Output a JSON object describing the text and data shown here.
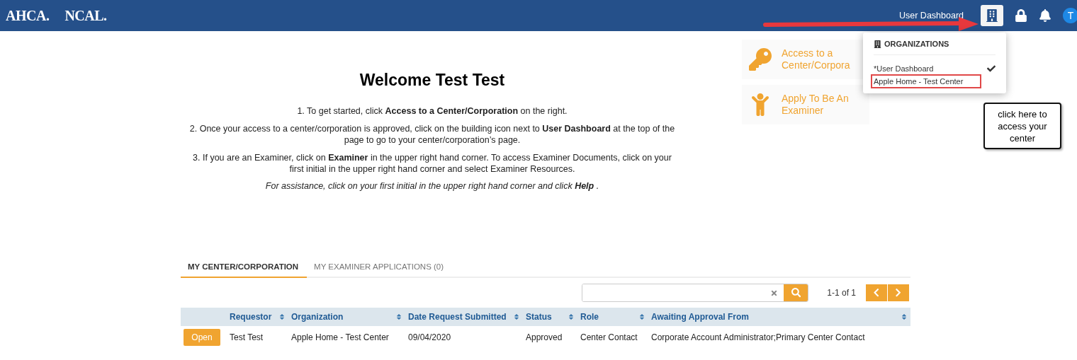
{
  "header": {
    "logos": [
      "AHCA.",
      "NCAL."
    ],
    "dashboard_label": "User Dashboard",
    "avatar": "T"
  },
  "welcome": {
    "title": "Welcome Test Test",
    "steps": [
      "1. To get started, click **Access to a Center/Corporation** on the right.",
      "2. Once your access to a center/corporation is approved, click on the building icon next to **User Dashboard** at the top of the page to go to your center/corporation’s page.",
      "3. If you are an Examiner, click on **Examiner** in the upper right hand corner. To access Examiner Documents, click on your first initial in the upper right hand corner and select Examiner Resources."
    ],
    "assistance": "For assistance, click on your first initial in the upper right hand corner and click **Help** ."
  },
  "action_cards": [
    {
      "kind": "key",
      "label": "Access to a Center/Corpora"
    },
    {
      "kind": "person",
      "label": "Apply To Be An Examiner"
    }
  ],
  "organizations_menu": {
    "title": "ORGANIZATIONS",
    "items": [
      {
        "label": "*User Dashboard",
        "selected": true,
        "highlighted": false
      },
      {
        "label": "Apple Home - Test Center",
        "selected": false,
        "highlighted": true
      }
    ]
  },
  "callout": "click here to access your center",
  "tabs": [
    {
      "label": "MY CENTER/CORPORATION",
      "selected": true
    },
    {
      "label": "MY EXAMINER APPLICATIONS (0)",
      "selected": false
    }
  ],
  "pagination": "1-1 of 1",
  "table": {
    "columns": [
      "Requestor",
      "Organization",
      "Date Request Submitted",
      "Status",
      "Role",
      "Awaiting Approval From"
    ],
    "rows": [
      {
        "action": "Open",
        "cells": [
          "Test Test",
          "Apple Home - Test Center",
          "09/04/2020",
          "Approved",
          "Center Contact",
          "Corporate Account Administrator;Primary Center Contact"
        ]
      }
    ]
  }
}
